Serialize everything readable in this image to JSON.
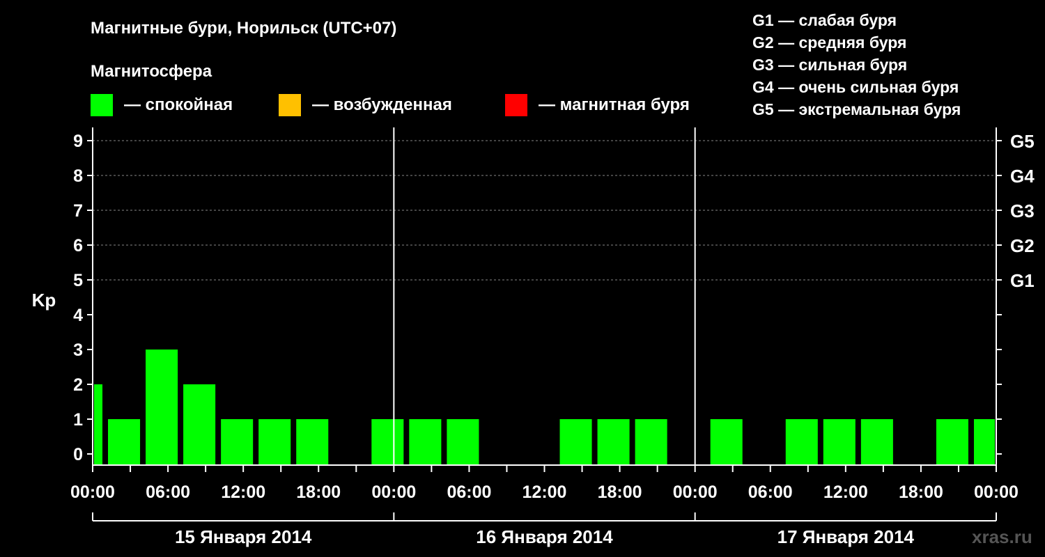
{
  "title": "Магнитные бури, Норильск (UTC+07)",
  "legend": {
    "heading": "Магнитосфера",
    "items": [
      {
        "label": "— спокойная",
        "color": "#00ff00"
      },
      {
        "label": "— возбужденная",
        "color": "#ffc000"
      },
      {
        "label": "— магнитная буря",
        "color": "#ff0000"
      }
    ]
  },
  "g_legend": [
    "G1 — слабая буря",
    "G2 — средняя буря",
    "G3 — сильная буря",
    "G4 — очень сильная буря",
    "G5 — экстремальная буря"
  ],
  "watermark": "xras.ru",
  "chart_data": {
    "type": "bar",
    "title": "Магнитные бури, Норильск (UTC+07)",
    "ylabel": "Kp",
    "ylim": [
      0,
      9
    ],
    "y_ticks": [
      "0",
      "1",
      "2",
      "3",
      "4",
      "5",
      "6",
      "7",
      "8",
      "9"
    ],
    "right_axis_labels": [
      {
        "kp": 5,
        "label": "G1"
      },
      {
        "kp": 6,
        "label": "G2"
      },
      {
        "kp": 7,
        "label": "G3"
      },
      {
        "kp": 8,
        "label": "G4"
      },
      {
        "kp": 9,
        "label": "G5"
      }
    ],
    "x_tick_labels": [
      "00:00",
      "06:00",
      "12:00",
      "18:00",
      "00:00",
      "06:00",
      "12:00",
      "18:00",
      "00:00",
      "06:00",
      "12:00",
      "18:00",
      "00:00"
    ],
    "days": [
      "15 Января 2014",
      "16 Января 2014",
      "17 Января 2014"
    ],
    "interval_hours": 3,
    "bars": [
      {
        "start_hour": 0,
        "end_hour": 1,
        "kp": 2
      },
      {
        "start_hour": 1,
        "end_hour": 4,
        "kp": 1
      },
      {
        "start_hour": 4,
        "end_hour": 7,
        "kp": 3
      },
      {
        "start_hour": 7,
        "end_hour": 10,
        "kp": 2
      },
      {
        "start_hour": 10,
        "end_hour": 13,
        "kp": 1
      },
      {
        "start_hour": 13,
        "end_hour": 16,
        "kp": 1
      },
      {
        "start_hour": 16,
        "end_hour": 19,
        "kp": 1
      },
      {
        "start_hour": 19,
        "end_hour": 22,
        "kp": 0
      },
      {
        "start_hour": 22,
        "end_hour": 25,
        "kp": 1
      },
      {
        "start_hour": 25,
        "end_hour": 28,
        "kp": 1
      },
      {
        "start_hour": 28,
        "end_hour": 31,
        "kp": 1
      },
      {
        "start_hour": 31,
        "end_hour": 34,
        "kp": 0
      },
      {
        "start_hour": 34,
        "end_hour": 37,
        "kp": 0
      },
      {
        "start_hour": 37,
        "end_hour": 40,
        "kp": 1
      },
      {
        "start_hour": 40,
        "end_hour": 43,
        "kp": 1
      },
      {
        "start_hour": 43,
        "end_hour": 46,
        "kp": 1
      },
      {
        "start_hour": 46,
        "end_hour": 49,
        "kp": 0
      },
      {
        "start_hour": 49,
        "end_hour": 52,
        "kp": 1
      },
      {
        "start_hour": 52,
        "end_hour": 55,
        "kp": 0
      },
      {
        "start_hour": 55,
        "end_hour": 58,
        "kp": 1
      },
      {
        "start_hour": 58,
        "end_hour": 61,
        "kp": 1
      },
      {
        "start_hour": 61,
        "end_hour": 64,
        "kp": 1
      },
      {
        "start_hour": 64,
        "end_hour": 67,
        "kp": 0
      },
      {
        "start_hour": 67,
        "end_hour": 70,
        "kp": 1
      },
      {
        "start_hour": 70,
        "end_hour": 72,
        "kp": 1
      }
    ],
    "bar_color": "#00ff00",
    "grid": "dashed horizontal at Kp 5–9"
  }
}
